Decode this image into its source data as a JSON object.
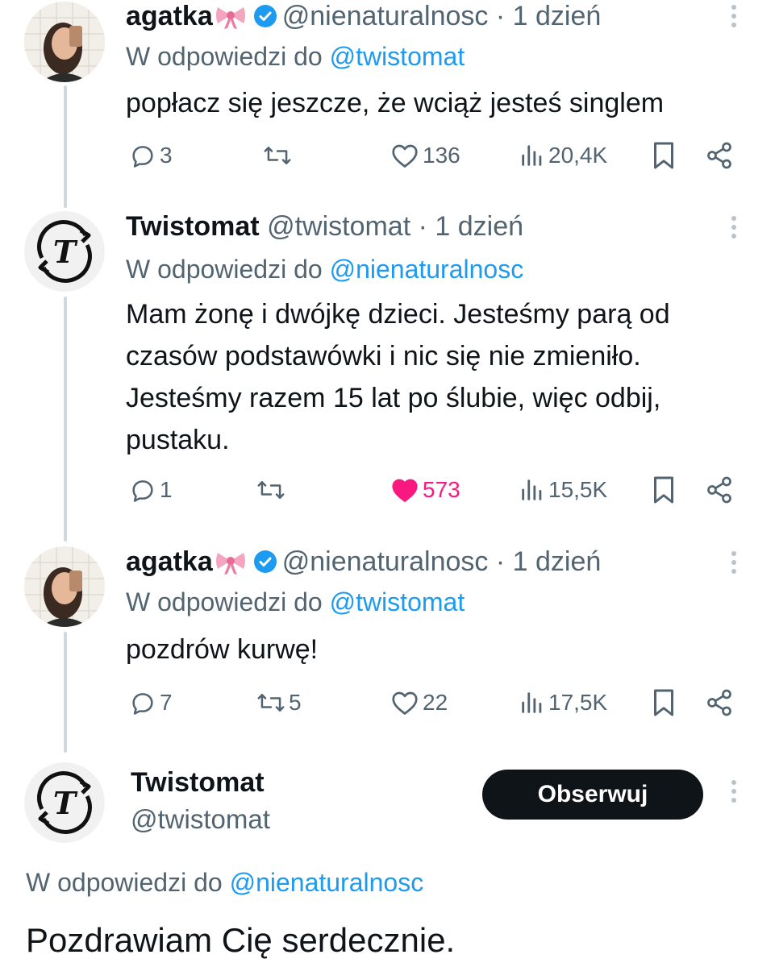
{
  "tweets": [
    {
      "name": "agatka",
      "handle": "@nienaturalnosc",
      "time": "· 1 dzień",
      "reply_prefix": "W odpowiedzi do",
      "reply_mention": "@twistomat",
      "text": "popłacz się jeszcze, że wciąż jesteś singlem",
      "replies": "3",
      "retweets": "",
      "likes": "136",
      "views": "20,4K",
      "liked": false
    },
    {
      "name": "Twistomat",
      "handle": "@twistomat",
      "time": "· 1 dzień",
      "reply_prefix": "W odpowiedzi do",
      "reply_mention": "@nienaturalnosc",
      "text_lines": [
        "Mam żonę i dwójkę dzieci. Jesteśmy parą od",
        "czasów podstawówki i nic się nie zmieniło.",
        "Jesteśmy razem 15 lat po ślubie, więc odbij,",
        "pustaku."
      ],
      "replies": "1",
      "retweets": "",
      "likes": "573",
      "views": "15,5K",
      "liked": true
    },
    {
      "name": "agatka",
      "handle": "@nienaturalnosc",
      "time": "· 1 dzień",
      "reply_prefix": "W odpowiedzi do",
      "reply_mention": "@twistomat",
      "text": "pozdrów kurwę!",
      "replies": "7",
      "retweets": "5",
      "likes": "22",
      "views": "17,5K",
      "liked": false
    }
  ],
  "main_tweet": {
    "name": "Twistomat",
    "handle": "@twistomat",
    "follow_label": "Obserwuj",
    "reply_prefix": "W odpowiedzi do",
    "reply_mention": "@nienaturalnosc",
    "text": "Pozdrawiam Cię serdecznie."
  },
  "colors": {
    "accent": "#1d9bf0",
    "like": "#f91880",
    "muted": "#536471",
    "thread_line": "#cfd9de"
  },
  "icons": [
    "reply-icon",
    "retweet-icon",
    "like-icon",
    "views-icon",
    "bookmark-icon",
    "share-icon",
    "verified-icon",
    "ribbon-emoji-icon",
    "more-icon"
  ]
}
